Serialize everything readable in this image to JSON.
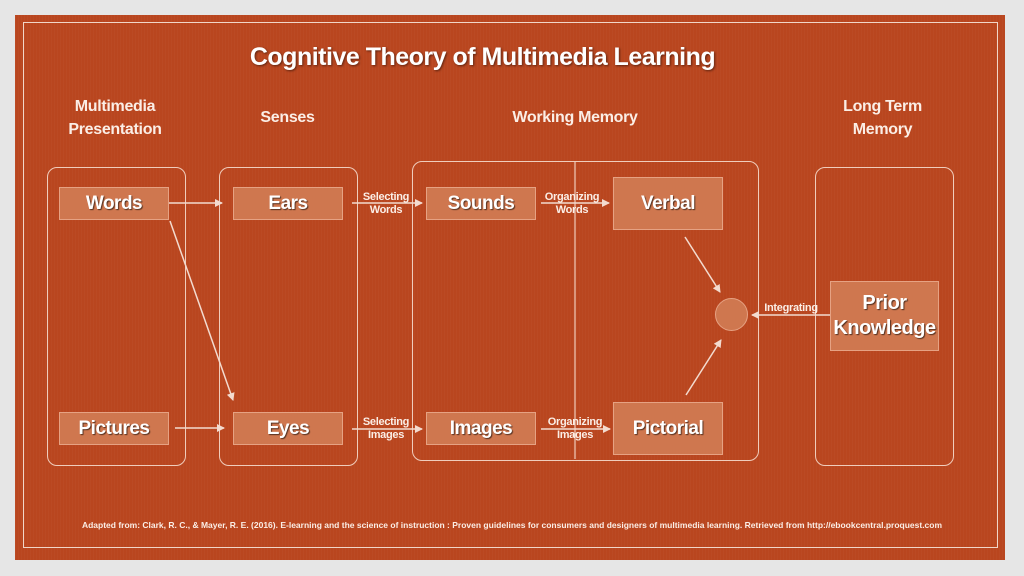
{
  "title": "Cognitive Theory of Multimedia Learning",
  "columns": {
    "presentation": "Multimedia\nPresentation",
    "senses": "Senses",
    "working_memory": "Working Memory",
    "long_term_memory": "Long Term\nMemory"
  },
  "boxes": {
    "words": "Words",
    "pictures": "Pictures",
    "ears": "Ears",
    "eyes": "Eyes",
    "sounds": "Sounds",
    "images": "Images",
    "verbal": "Verbal",
    "pictorial": "Pictorial",
    "prior_knowledge": "Prior Knowledge"
  },
  "processes": {
    "selecting_words": "Selecting Words",
    "selecting_images": "Selecting Images",
    "organizing_words": "Organizing Words",
    "organizing_images": "Organizing Images",
    "integrating": "Integrating"
  },
  "footer": "Adapted from:  Clark, R. C., & Mayer, R. E. (2016). E-learning and the science of instruction : Proven guidelines for consumers and designers of multimedia learning. Retrieved from http://ebookcentral.proquest.com",
  "colors": {
    "background": "#b9461f",
    "box": "#cf774f",
    "line": "#f0cdbc"
  }
}
